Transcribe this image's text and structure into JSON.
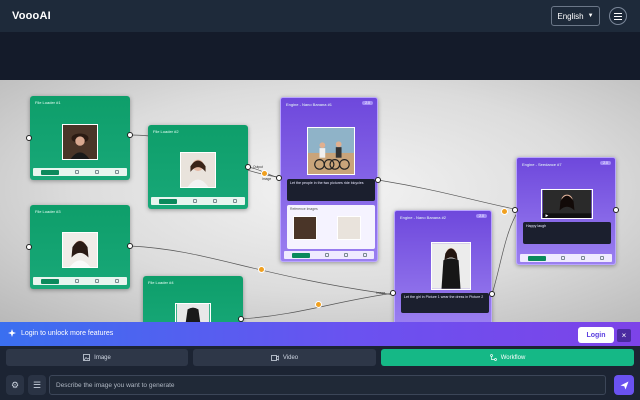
{
  "header": {
    "brand": "VoooAI",
    "language": "English"
  },
  "canvas": {
    "nodes": [
      {
        "title": "File Loader #1"
      },
      {
        "title": "File Loader #2"
      },
      {
        "title": "File Loader #3"
      },
      {
        "title": "File Loader #4"
      },
      {
        "title": "Engine - Nano Banana #1",
        "badge": "2.0"
      },
      {
        "title": "Engine - Nano Banana #2",
        "badge": "2.0"
      },
      {
        "title": "Engine - Seedance #7",
        "badge": "2.0"
      }
    ],
    "prompt_1": "Let the people in the two pictures ride bicycles",
    "reference_label": "Reference Images",
    "prompt_2": "Let the girl in Picture 1 wear the dress in Picture 2",
    "prompt_3": "Happy laugh",
    "port_labels": {
      "image": "Image",
      "output": "Output"
    }
  },
  "login_bar": {
    "message": "Login to unlock more features",
    "button": "Login",
    "close": "×"
  },
  "tabs": [
    {
      "label": "Image",
      "icon": "image-icon"
    },
    {
      "label": "Video",
      "icon": "video-icon"
    },
    {
      "label": "Workflow",
      "icon": "workflow-icon",
      "active": true
    }
  ],
  "prompt_input": {
    "placeholder": "Describe the image you want to generate"
  },
  "colors": {
    "accent_green": "#15b886",
    "accent_purple": "#6a52f0",
    "header_bg": "#1e2a3a"
  }
}
